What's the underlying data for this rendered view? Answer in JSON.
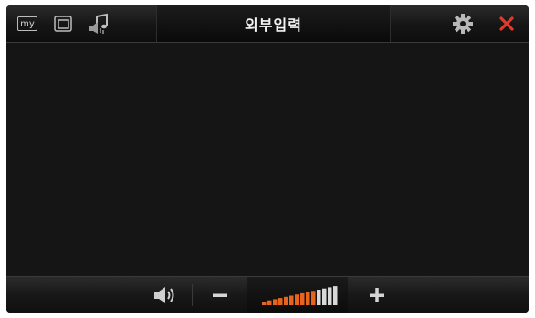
{
  "window": {
    "title": "외부입력"
  },
  "toolbar": {
    "my_label": "my",
    "icons": [
      "my-icon",
      "window-icon",
      "music-settings-icon",
      "gear-icon",
      "close-icon"
    ]
  },
  "volume": {
    "level": 0.71,
    "icons": [
      "speaker-icon",
      "minus-icon",
      "plus-icon"
    ]
  },
  "colors": {
    "accent_orange": "#e8641e",
    "close_red": "#e23a2a",
    "background": "#151515"
  }
}
